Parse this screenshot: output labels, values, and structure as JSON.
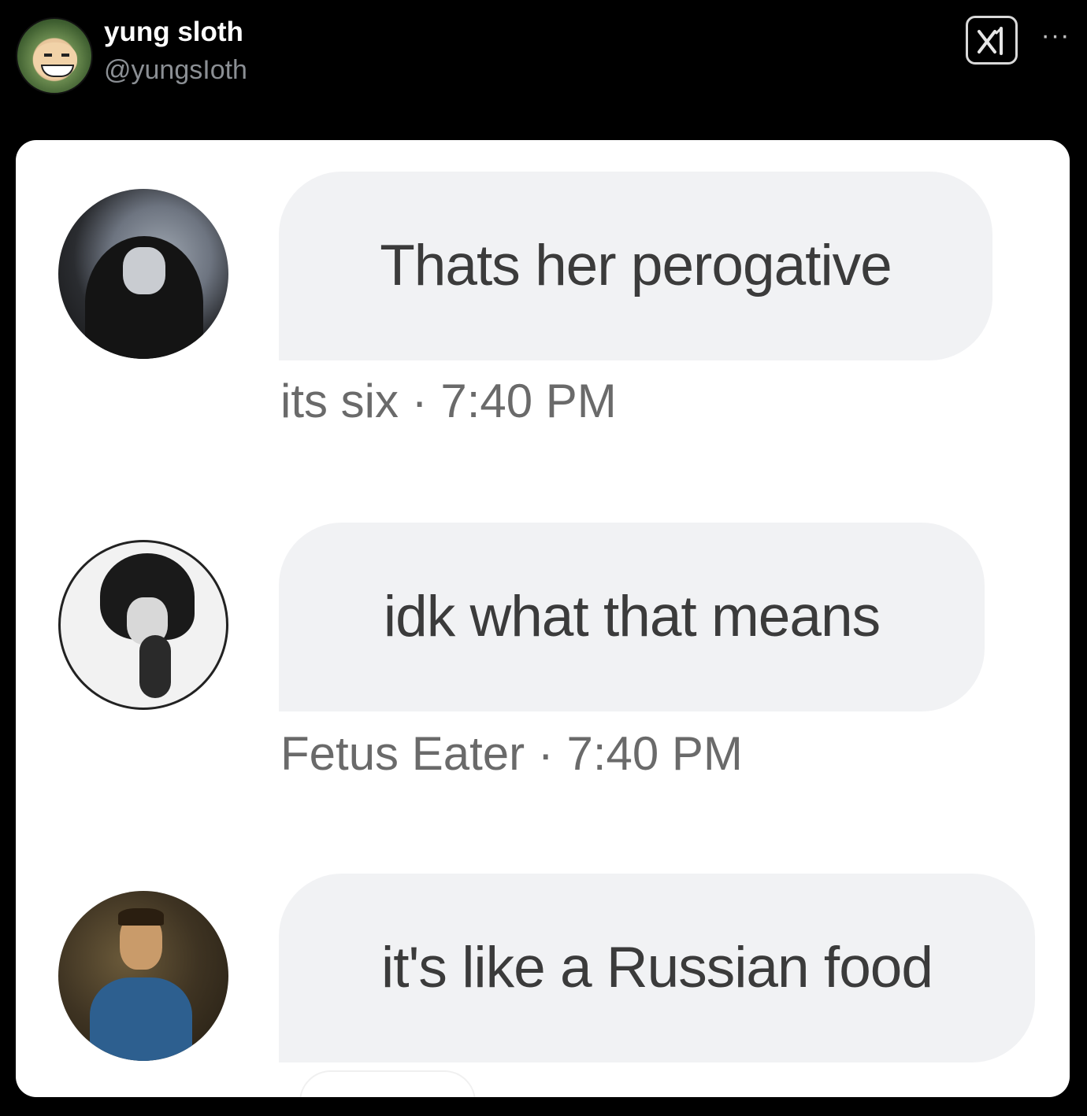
{
  "post": {
    "author_name": "yung sloth",
    "author_handle": "@yungsIoth"
  },
  "icons": {
    "grok": "grok-icon",
    "more": "more-icon"
  },
  "more_label": "···",
  "messages": [
    {
      "text": "Thats her perogative",
      "sender": "its six",
      "time": "7:40 PM",
      "meta": "its six · 7:40 PM"
    },
    {
      "text": "idk what that means",
      "sender": "Fetus Eater",
      "time": "7:40 PM",
      "meta": "Fetus Eater · 7:40 PM"
    },
    {
      "text": "it's like a Russian food",
      "sender": "",
      "time": "",
      "meta": ""
    }
  ],
  "colors": {
    "background": "#000000",
    "card": "#ffffff",
    "bubble": "#f1f2f4",
    "message_text": "#3b3b3b",
    "meta_text": "#6a6a6a",
    "handle_text": "#8b8f94"
  }
}
